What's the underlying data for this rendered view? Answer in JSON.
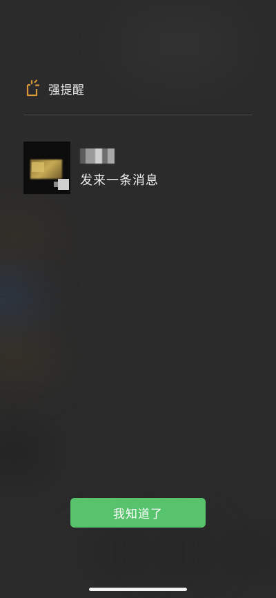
{
  "alert": {
    "icon": "reminder-bell-icon",
    "icon_color": "#d99a3a",
    "title": "强提醒"
  },
  "message": {
    "sender_name": "",
    "body": "发来一条消息"
  },
  "actions": {
    "confirm_label": "我知道了",
    "confirm_color": "#57c36c"
  }
}
